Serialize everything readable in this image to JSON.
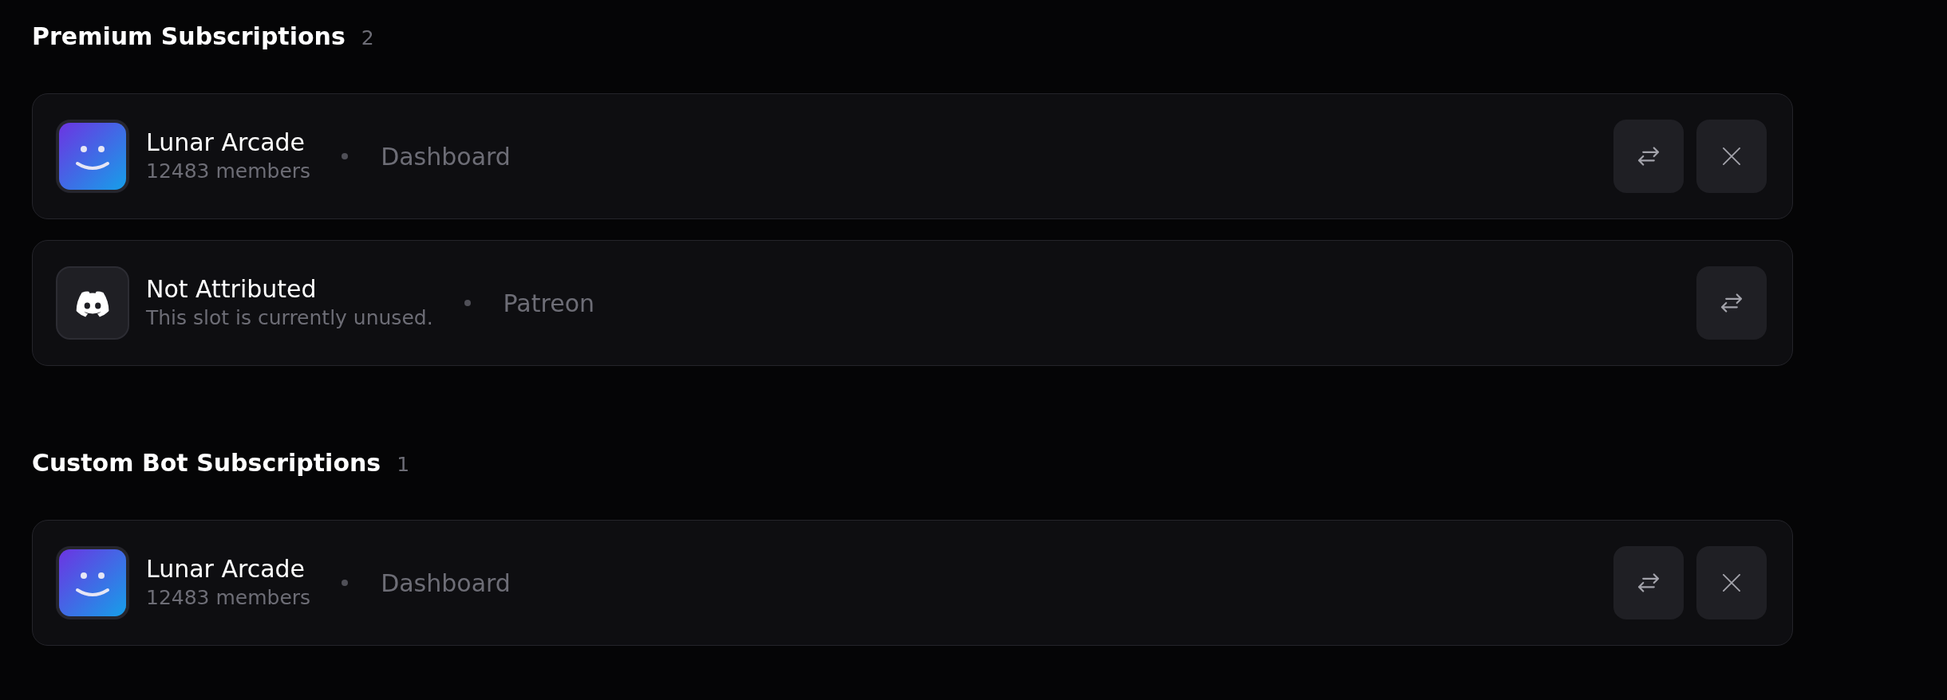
{
  "sections": [
    {
      "title": "Premium Subscriptions",
      "count": "2",
      "items": [
        {
          "kind": "server",
          "name": "Lunar Arcade",
          "subtitle": "12483 members",
          "source": "Dashboard",
          "removable": true
        },
        {
          "kind": "unattributed",
          "name": "Not Attributed",
          "subtitle": "This slot is currently unused.",
          "source": "Patreon",
          "removable": false
        }
      ]
    },
    {
      "title": "Custom Bot Subscriptions",
      "count": "1",
      "items": [
        {
          "kind": "server",
          "name": "Lunar Arcade",
          "subtitle": "12483 members",
          "source": "Dashboard",
          "removable": true
        }
      ]
    }
  ]
}
